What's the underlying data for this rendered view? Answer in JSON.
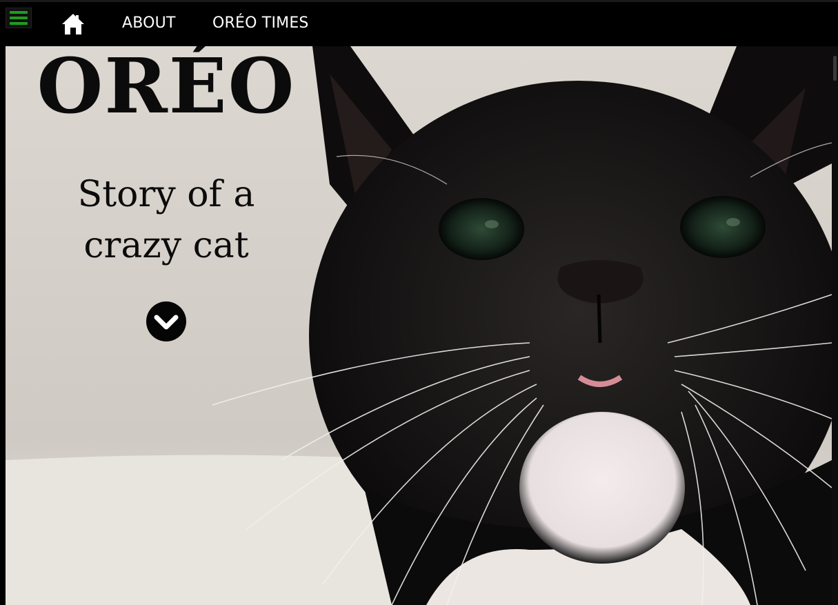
{
  "nav": {
    "menu_icon": "hamburger-icon",
    "home_icon": "home-icon",
    "links": [
      {
        "label": "ABOUT"
      },
      {
        "label": "ORÉO TIMES"
      }
    ]
  },
  "hero": {
    "title": "ORÉO",
    "subtitle": "Story of a crazy cat",
    "scroll_icon": "chevron-down-circle-icon"
  },
  "colors": {
    "menu_accent": "#1f9d1f",
    "nav_bg": "#000000",
    "hero_bg": "#d9d4cd"
  }
}
